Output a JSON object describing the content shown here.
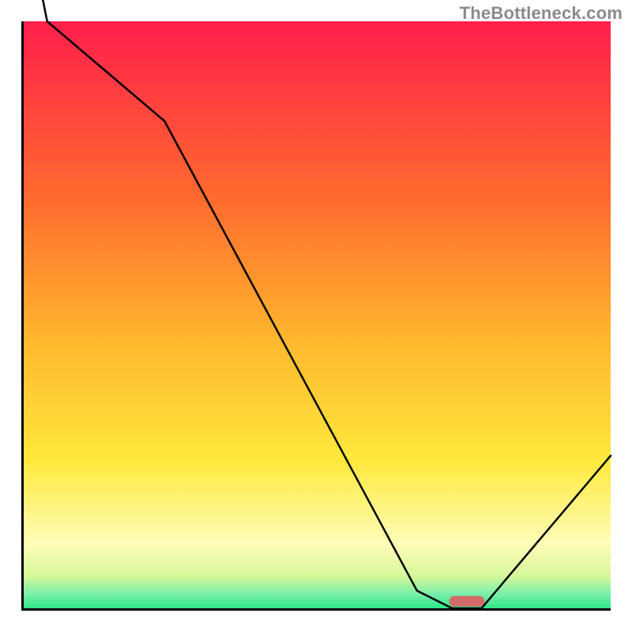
{
  "watermark": "TheBottleneck.com",
  "colors": {
    "top": "#ff1f4b",
    "mid_orange": "#ff8a2a",
    "mid_yellow": "#ffe93d",
    "pale_yellow": "#fffdb8",
    "green": "#2fe68a",
    "marker": "#d46a6a",
    "axis": "#000000"
  },
  "chart_data": {
    "type": "line",
    "title": "",
    "xlabel": "",
    "ylabel": "",
    "xlim": [
      0,
      100
    ],
    "ylim": [
      0,
      100
    ],
    "x": [
      0,
      4,
      24,
      67,
      73,
      78,
      100
    ],
    "values": [
      120,
      100,
      83,
      3,
      0,
      0,
      26
    ],
    "marker": {
      "x": 75.5,
      "y": 1.2,
      "width": 6,
      "height": 1.8
    },
    "gradient_stops": [
      {
        "pos": 0.0,
        "color": "#ff1f4b"
      },
      {
        "pos": 0.3,
        "color": "#ff6a2f"
      },
      {
        "pos": 0.55,
        "color": "#ffb92e"
      },
      {
        "pos": 0.75,
        "color": "#ffe93d"
      },
      {
        "pos": 0.89,
        "color": "#fffdb8"
      },
      {
        "pos": 0.945,
        "color": "#d6f79a"
      },
      {
        "pos": 0.975,
        "color": "#7cefaa"
      },
      {
        "pos": 1.0,
        "color": "#2fe68a"
      }
    ]
  }
}
